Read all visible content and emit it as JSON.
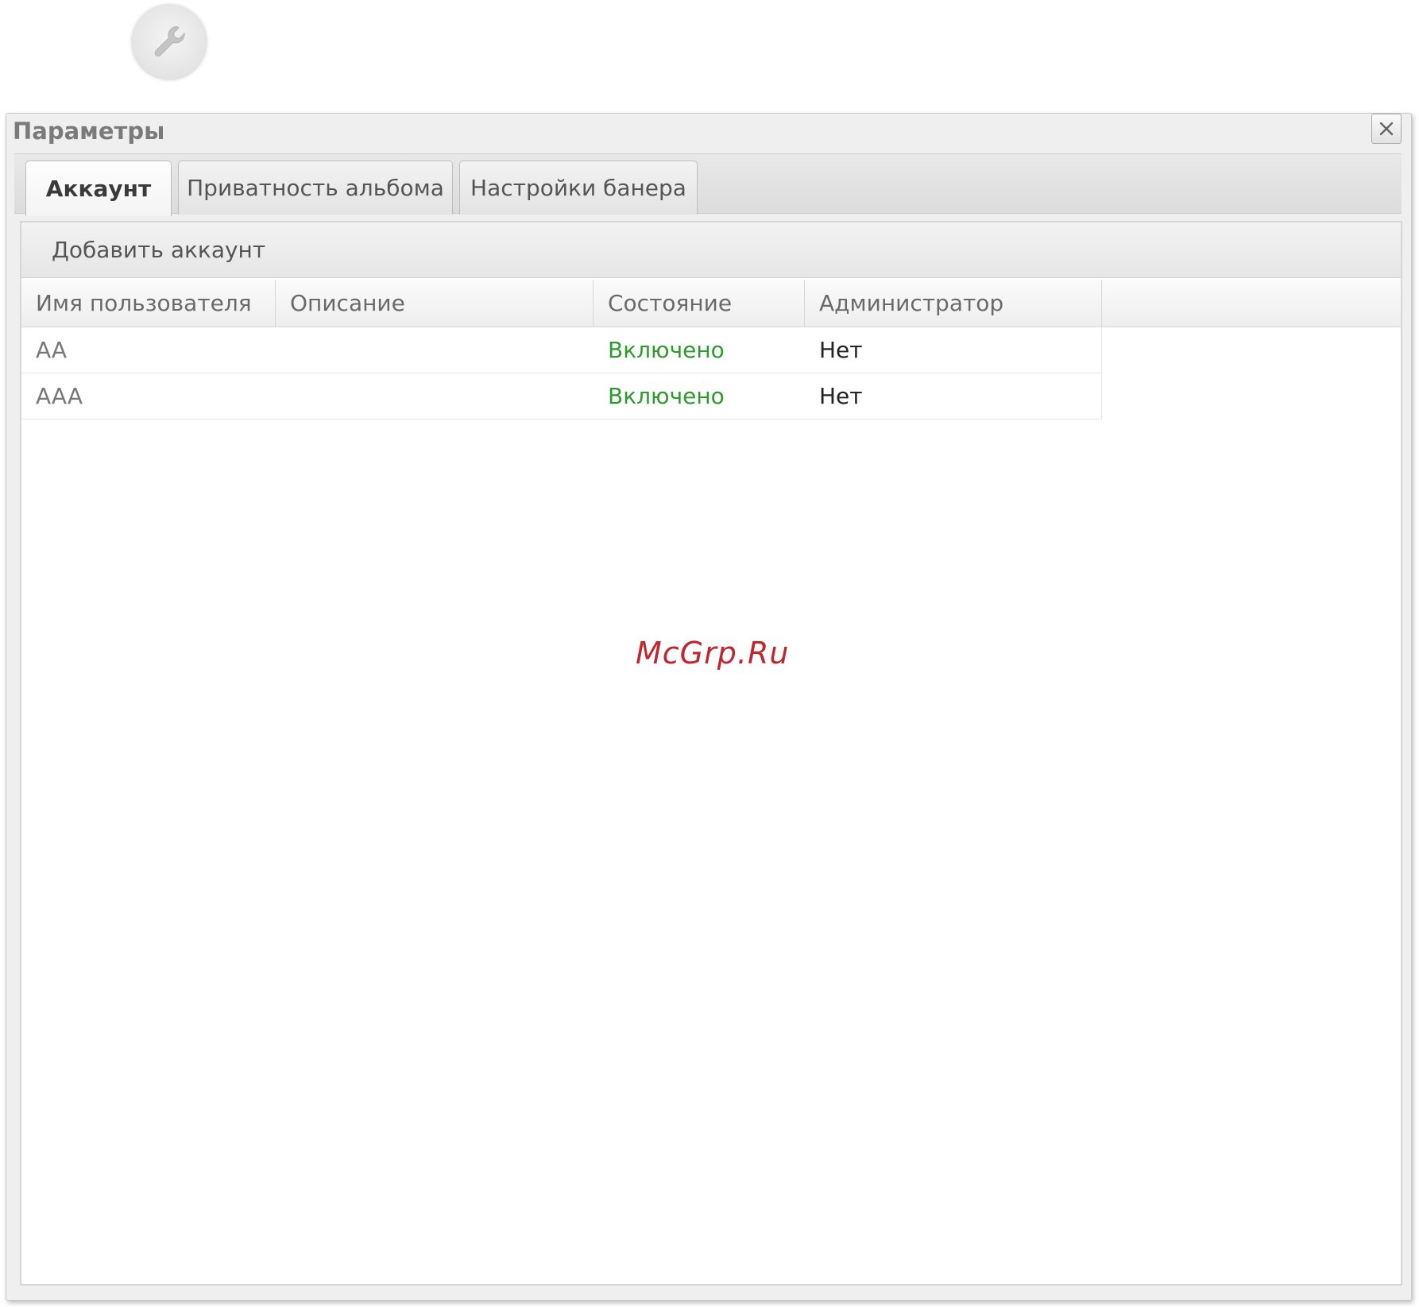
{
  "settings_button": {
    "icon": "wrench-icon"
  },
  "dialog": {
    "title": "Параметры",
    "close_icon": "close-icon"
  },
  "tabs": [
    {
      "label": "Аккаунт",
      "active": true
    },
    {
      "label": "Приватность альбома",
      "active": false
    },
    {
      "label": "Настройки банера",
      "active": false
    }
  ],
  "toolbar": {
    "add_account_label": "Добавить аккаунт"
  },
  "grid": {
    "columns": [
      "Имя пользователя",
      "Описание",
      "Состояние",
      "Администратор"
    ],
    "rows": [
      {
        "username": "AA",
        "description": "",
        "status": "Включено",
        "admin": "Нет"
      },
      {
        "username": "AAA",
        "description": "",
        "status": "Включено",
        "admin": "Нет"
      }
    ]
  },
  "colors": {
    "status_enabled": "#2c9a2c",
    "watermark": "#c0262d"
  },
  "watermark": "McGrp.Ru"
}
